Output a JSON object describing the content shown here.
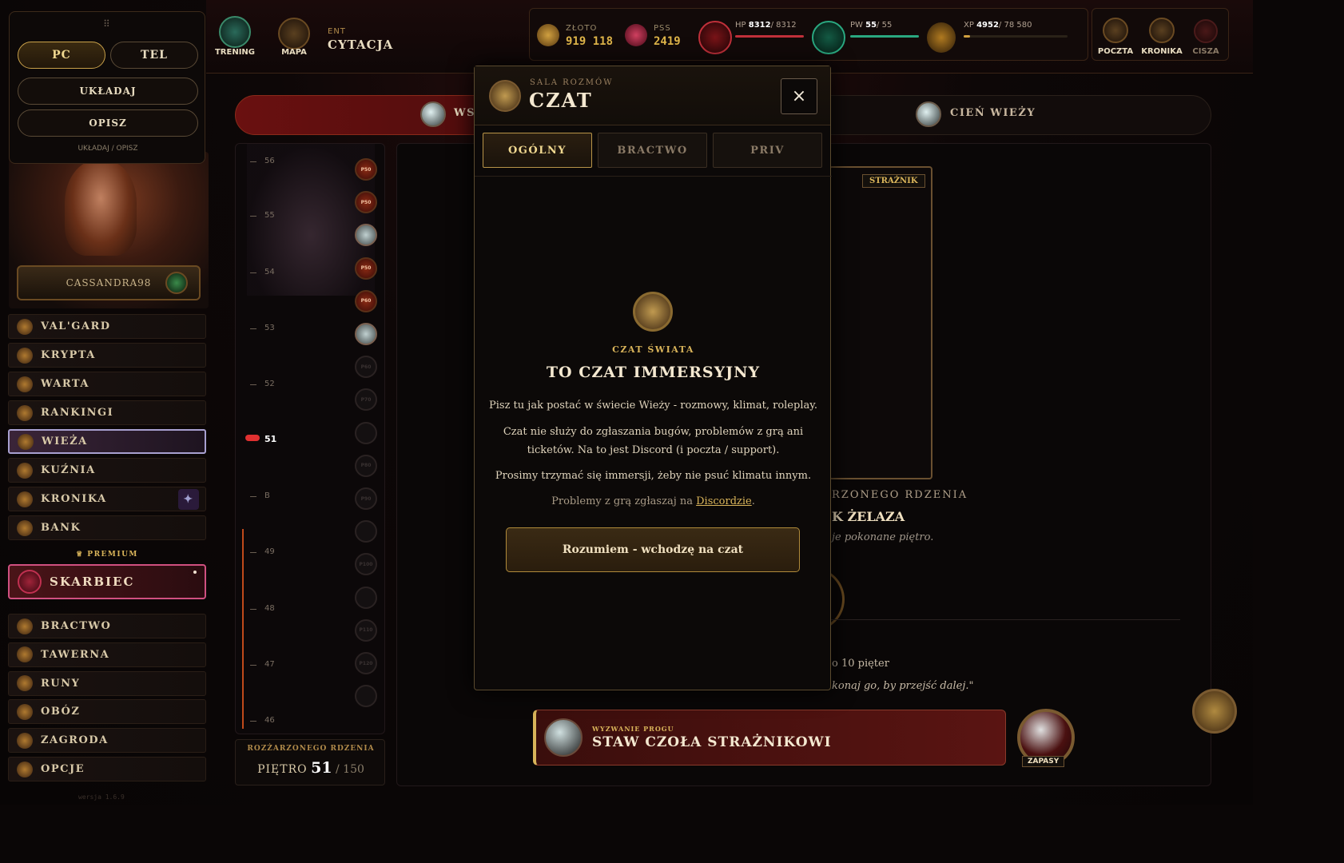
{
  "toolpanel": {
    "pc": "PC",
    "tel": "TEL",
    "ukladaj": "UKŁADAJ",
    "opisz": "OPISZ",
    "mode_label": "UKŁADAJ / OPISZ"
  },
  "profile": {
    "username": "CASSANDRA98"
  },
  "nav": [
    {
      "label": "VAL'GARD",
      "icon": "city-icon"
    },
    {
      "label": "KRYPTA",
      "icon": "crypt-icon"
    },
    {
      "label": "WARTA",
      "icon": "guard-icon"
    },
    {
      "label": "RANKINGI",
      "icon": "ranking-icon"
    },
    {
      "label": "WIEŻA",
      "icon": "tower-icon"
    },
    {
      "label": "KUŹNIA",
      "icon": "forge-icon"
    },
    {
      "label": "KRONIKA",
      "icon": "chronicle-icon"
    },
    {
      "label": "BANK",
      "icon": "bank-icon"
    }
  ],
  "premium": {
    "label": "PREMIUM",
    "skarbiec": "SKARBIEC"
  },
  "nav2": [
    {
      "label": "BRACTWO",
      "icon": "brotherhood-icon"
    },
    {
      "label": "TAWERNA",
      "icon": "tavern-icon"
    },
    {
      "label": "RUNY",
      "icon": "runes-icon"
    },
    {
      "label": "OBÓZ",
      "icon": "camp-icon"
    },
    {
      "label": "ZAGRODA",
      "icon": "farm-icon"
    },
    {
      "label": "OPCJE",
      "icon": "options-icon"
    }
  ],
  "version": "wersja 1.6.9",
  "topbar": {
    "trening": "TRENING",
    "mapa": "MAPA",
    "location_small": "ENT",
    "location": "CYTACJA",
    "zloto_label": "ZŁOTO",
    "zloto_value": "919 118",
    "pss_label": "PSS",
    "pss_value": "2419",
    "hp_label": "HP",
    "hp_value": "8312",
    "hp_max": "/ 8312",
    "pw_label": "PW",
    "pw_value": "55",
    "pw_max": "/ 55",
    "xp_label": "XP",
    "xp_value": "4952",
    "xp_max": "/ 78 580",
    "poczta": "POCZTA",
    "kronika": "KRONIKA",
    "cisza": "CISZA",
    "hp_color": "#c0303a",
    "pw_color": "#2aa880",
    "xp_fraction": 0.063
  },
  "tabs": {
    "left": "WS",
    "right": "CIEŃ WIEŻY"
  },
  "floors": {
    "labels": [
      "56",
      "55",
      "54",
      "53",
      "52",
      "51",
      "B",
      "49",
      "48",
      "47",
      "46"
    ],
    "badges": [
      "P50",
      "P50",
      "",
      "P50",
      "P60",
      "",
      "P60",
      "P70",
      "",
      "P80",
      "P90",
      "",
      "P100",
      "",
      "P110",
      "P120",
      ""
    ],
    "footer_small": "ROZŻARZONEGO RDZENIA",
    "footer_label": "PIĘTRO",
    "current": "51",
    "total": "/ 150"
  },
  "main": {
    "guardian_badge": "STRAŻNIK",
    "core_title": "RZONEGO RDZENIA",
    "guardian_name": "K ŻELAZA",
    "desc": "je pokonane piętro.",
    "ten_floors": "o 10 pięter",
    "quote": "konaj go, by przejść dalej.\"",
    "challenge_small": "WYZWANIE PROGU",
    "challenge": "STAW CZOŁA STRAŻNIKOWI",
    "supplies": "ZAPASY"
  },
  "modal": {
    "subtitle": "SALA ROZMÓW",
    "title": "CZAT",
    "close": "×",
    "tabs": [
      "OGÓLNY",
      "BRACTWO",
      "PRIV"
    ],
    "world_label": "CZAT ŚWIATA",
    "heading": "TO CZAT IMMERSYJNY",
    "p1": "Pisz tu jak postać w świecie Wieży - rozmowy, klimat, roleplay.",
    "p2a": "Czat nie służy do zgłaszania bugów, problemów z grą ani",
    "p2b": "ticketów. Na to jest Discord (i poczta / support).",
    "p3": "Prosimy trzymać się immersji, żeby nie psuć klimatu innym.",
    "p4": "Problemy z grą zgłaszaj na ",
    "p4_link": "Discordzie",
    "p4_end": ".",
    "cta": "Rozumiem - wchodzę na czat"
  }
}
